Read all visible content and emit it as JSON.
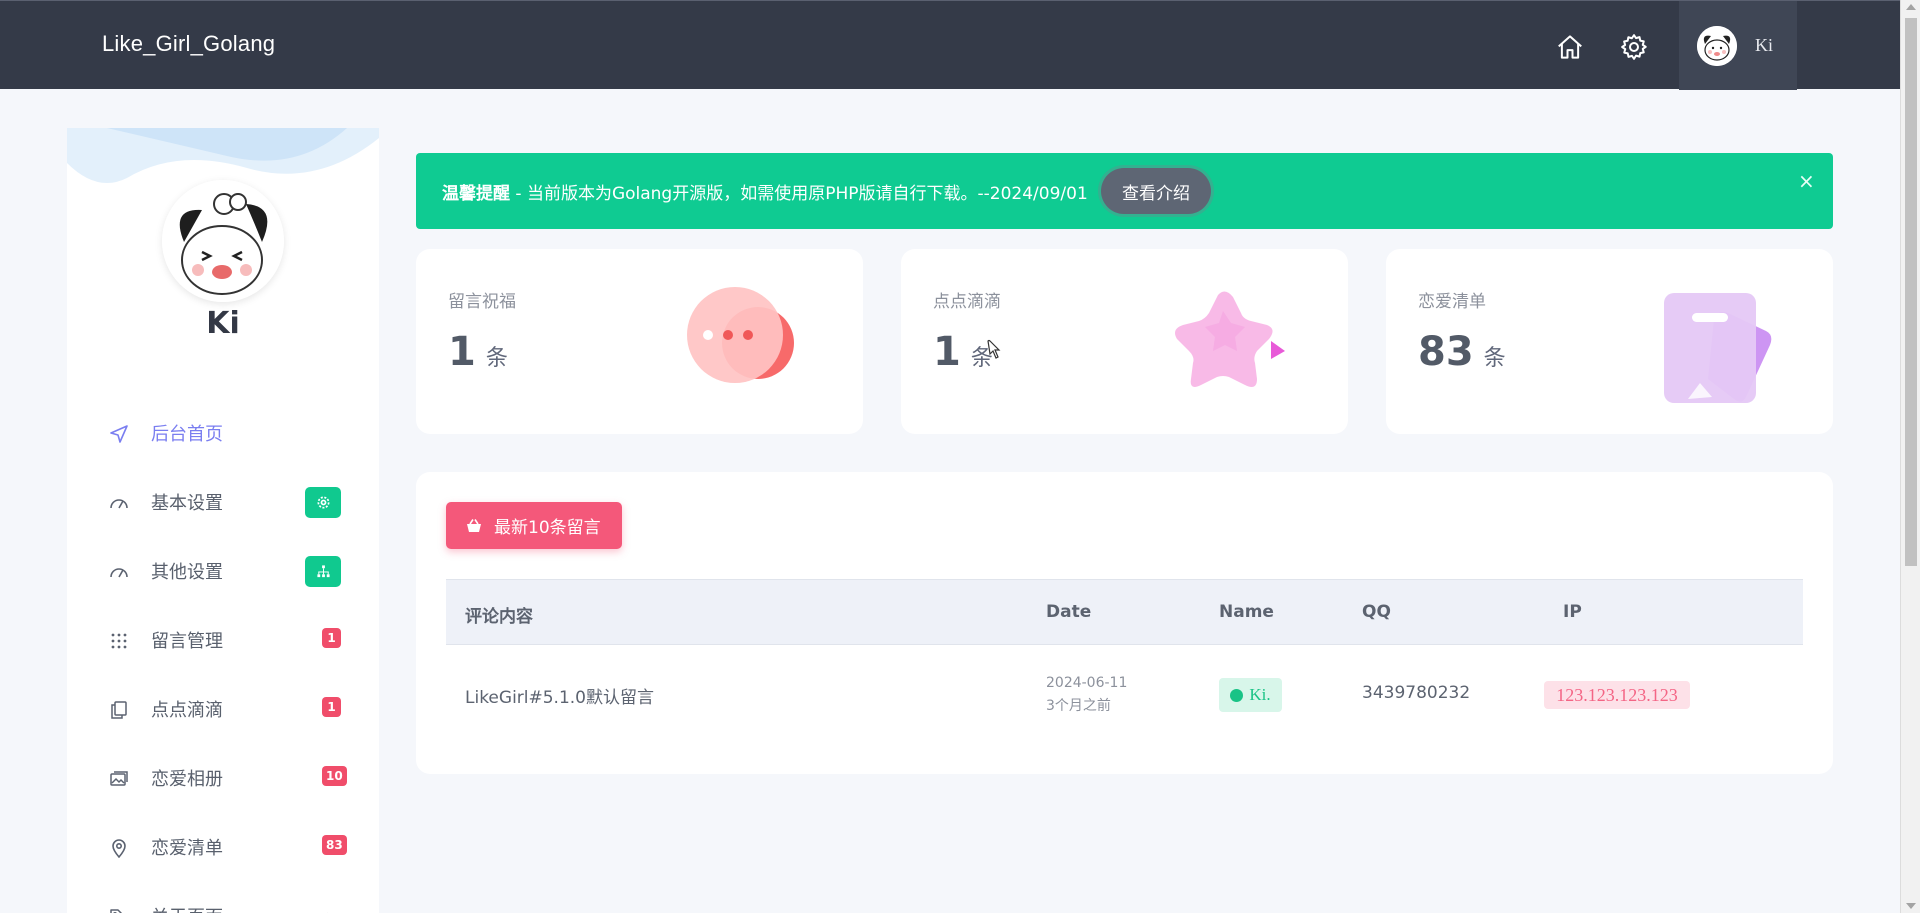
{
  "brand": "Like_Girl_Golang",
  "topbar": {
    "home_icon": "home-icon",
    "settings_icon": "gear-icon",
    "user_name": "Ki"
  },
  "profile": {
    "name": "Ki"
  },
  "sidebar": {
    "items": [
      {
        "label": "后台首页",
        "icon": "send-icon",
        "active": true
      },
      {
        "label": "基本设置",
        "icon": "gauge-icon",
        "badge_icon": "gear-icon"
      },
      {
        "label": "其他设置",
        "icon": "gauge-icon",
        "badge_icon": "sitemap-icon"
      },
      {
        "label": "留言管理",
        "icon": "grid-icon",
        "badge": "1"
      },
      {
        "label": "点点滴滴",
        "icon": "copy-icon",
        "badge": "1"
      },
      {
        "label": "恋爱相册",
        "icon": "images-icon",
        "badge": "10"
      },
      {
        "label": "恋爱清单",
        "icon": "map-pin-icon",
        "badge": "83"
      },
      {
        "label": "关于页面",
        "icon": "tags-icon",
        "chevron": "›"
      }
    ]
  },
  "alert": {
    "strong": "温馨提醒",
    "text": " - 当前版本为Golang开源版，如需使用原PHP版请自行下载。--2024/09/01",
    "button": "查看介绍",
    "close": "×",
    "color": "#0fcb92"
  },
  "stats": [
    {
      "title": "留言祝福",
      "value": "1",
      "unit": "条"
    },
    {
      "title": "点点滴滴",
      "value": "1",
      "unit": "条"
    },
    {
      "title": "恋爱清单",
      "value": "83",
      "unit": "条"
    }
  ],
  "panel": {
    "button": "最新10条留言",
    "columns": [
      "评论内容",
      "Date",
      "Name",
      "QQ",
      "IP"
    ],
    "rows": [
      {
        "content": "LikeGirl#5.1.0默认留言",
        "date": "2024-06-11",
        "date_relative": "3个月之前",
        "name": "Ki.",
        "qq": "3439780232",
        "ip": "123.123.123.123"
      }
    ]
  },
  "colors": {
    "topbar": "#343a48",
    "accent_pink": "#f4587a",
    "accent_green": "#10c98f",
    "active_nav": "#7a7ef0"
  }
}
